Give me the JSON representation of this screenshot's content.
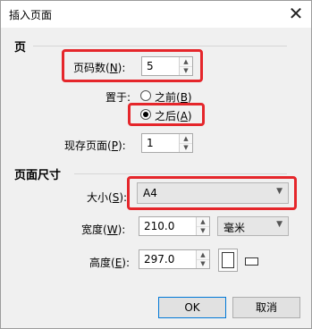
{
  "window": {
    "title": "插入页面",
    "close_glyph": "✕"
  },
  "page_section": {
    "heading": "页",
    "page_count": {
      "label_pre": "页码数(",
      "accel": "N",
      "label_post": "):",
      "value": "5"
    },
    "position": {
      "label_pre": "置于:",
      "options": [
        {
          "pre": "之前(",
          "accel": "B",
          "post": ")",
          "checked": false
        },
        {
          "pre": "之后(",
          "accel": "A",
          "post": ")",
          "checked": true
        }
      ]
    },
    "existing_page": {
      "label_pre": "现存页面(",
      "accel": "P",
      "label_post": "):",
      "value": "1"
    }
  },
  "size_section": {
    "heading": "页面尺寸",
    "size": {
      "label_pre": "大小(",
      "accel": "S",
      "label_post": "):",
      "value": "A4"
    },
    "width": {
      "label_pre": "宽度(",
      "accel": "W",
      "label_post": "):",
      "value": "210.0",
      "unit": "毫米"
    },
    "height": {
      "label_pre": "高度(",
      "accel": "E",
      "label_post": "):",
      "value": "297.0"
    }
  },
  "buttons": {
    "ok": "OK",
    "cancel": "取消"
  },
  "colors": {
    "highlight": "#e5262b",
    "accent": "#0078d7"
  }
}
